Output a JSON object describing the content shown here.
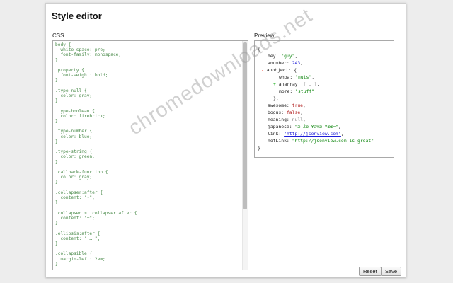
{
  "page": {
    "title": "Style editor"
  },
  "css_panel": {
    "label": "CSS",
    "code_lines": [
      "body {",
      "  white-space: pre;",
      "  font-family: monospace;",
      "}",
      "",
      ".property {",
      "  font-weight: bold;",
      "}",
      "",
      ".type-null {",
      "  color: gray;",
      "}",
      "",
      ".type-boolean {",
      "  color: firebrick;",
      "}",
      "",
      ".type-number {",
      "  color: blue;",
      "}",
      "",
      ".type-string {",
      "  color: green;",
      "}",
      "",
      ".callback-function {",
      "  color: gray;",
      "}",
      "",
      ".collapser:after {",
      "  content: \"-\";",
      "}",
      "",
      ".collapsed > .collapser:after {",
      "  content: \"+\";",
      "}",
      "",
      ".ellipsis:after {",
      "  content: \" … \";",
      "}",
      "",
      ".collapsible {",
      "  margin-left: 2em;",
      "}"
    ]
  },
  "preview_panel": {
    "label": "Preview",
    "open_brace": "{",
    "hey_key": "hey: ",
    "hey_val": "\"guy\"",
    "comma": ",",
    "anumber_key": "anumber: ",
    "anumber_val": "243",
    "collapser_minus": "- ",
    "anobject_key": "anobject: ",
    "brace_open": "{",
    "whoa_key": "whoa: ",
    "whoa_val": "\"nuts\"",
    "collapser_plus": "+ ",
    "anarray_key": "anarray: ",
    "anarray_val": "[ … ]",
    "more_key": "more: ",
    "more_val": "\"stuff\"",
    "brace_close_comma": "},",
    "awesome_key": "awesome: ",
    "awesome_val": "true",
    "bogus_key": "bogus: ",
    "bogus_val": "false",
    "meaning_key": "meaning: ",
    "meaning_val": "null",
    "japanese_key": "japanese: ",
    "japanese_val": "\"æ˜Žæ—¥ã®æ—¥æœ¬\"",
    "link_key": "link: ",
    "link_val": "\"http://jsonview.com\"",
    "notlink_key": "notLink: ",
    "notlink_val": "\"http://jsonview.com is great\"",
    "close_brace": "}"
  },
  "buttons": {
    "reset": "Reset",
    "save": "Save"
  },
  "watermark": "chromedownloads.net"
}
